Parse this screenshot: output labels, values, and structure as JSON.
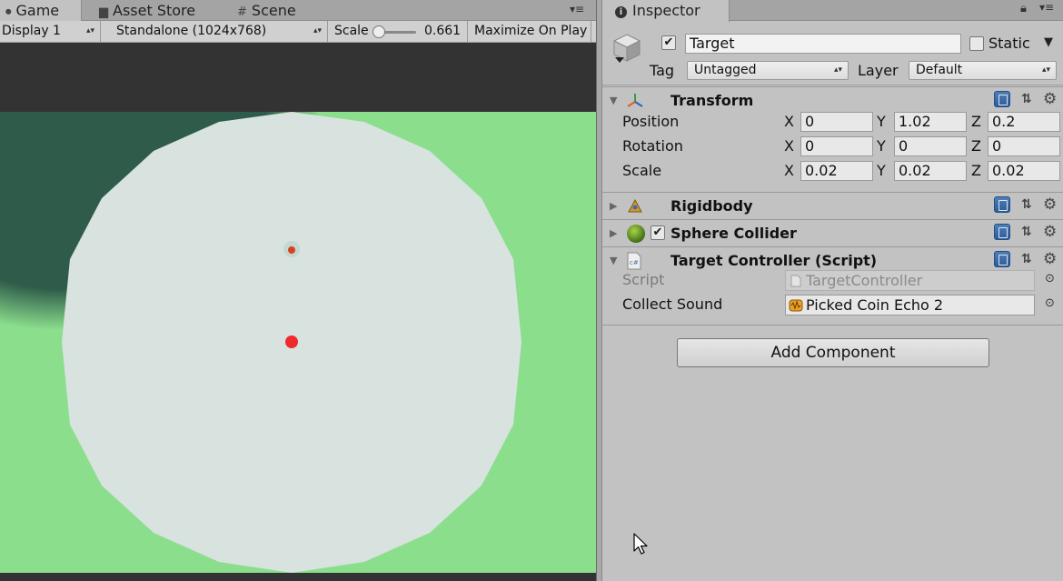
{
  "game_panel": {
    "tabs": [
      {
        "label": "Game",
        "icon": "game-controller-icon"
      },
      {
        "label": "Asset Store",
        "icon": "asset-store-icon"
      },
      {
        "label": "Scene",
        "icon": "scene-grid-icon"
      }
    ],
    "toolbar": {
      "display": "Display 1",
      "resolution": "Standalone (1024x768)",
      "scale_label": "Scale",
      "scale_value": "0.661",
      "maximize_on_play": "Maximize On Play"
    },
    "colors": {
      "ground": "#8ade8c",
      "shadow": "#2f5b4a",
      "disc": "#d8e2df",
      "dot": "#ee2a2a"
    }
  },
  "inspector": {
    "tab_label": "Inspector",
    "object": {
      "active": true,
      "name": "Target",
      "static_label": "Static",
      "tag_label": "Tag",
      "tag_value": "Untagged",
      "layer_label": "Layer",
      "layer_value": "Default"
    },
    "transform": {
      "title": "Transform",
      "rows": [
        {
          "label": "Position",
          "x": "0",
          "y": "1.02",
          "z": "0.2"
        },
        {
          "label": "Rotation",
          "x": "0",
          "y": "0",
          "z": "0"
        },
        {
          "label": "Scale",
          "x": "0.02",
          "y": "0.02",
          "z": "0.02"
        }
      ],
      "axes": [
        "X",
        "Y",
        "Z"
      ]
    },
    "rigidbody": {
      "title": "Rigidbody"
    },
    "sphere_collider": {
      "title": "Sphere Collider",
      "enabled": true
    },
    "target_controller": {
      "title": "Target Controller (Script)",
      "script_label": "Script",
      "script_value": "TargetController",
      "sound_label": "Collect Sound",
      "sound_value": "Picked Coin Echo 2"
    },
    "add_component": "Add Component"
  }
}
